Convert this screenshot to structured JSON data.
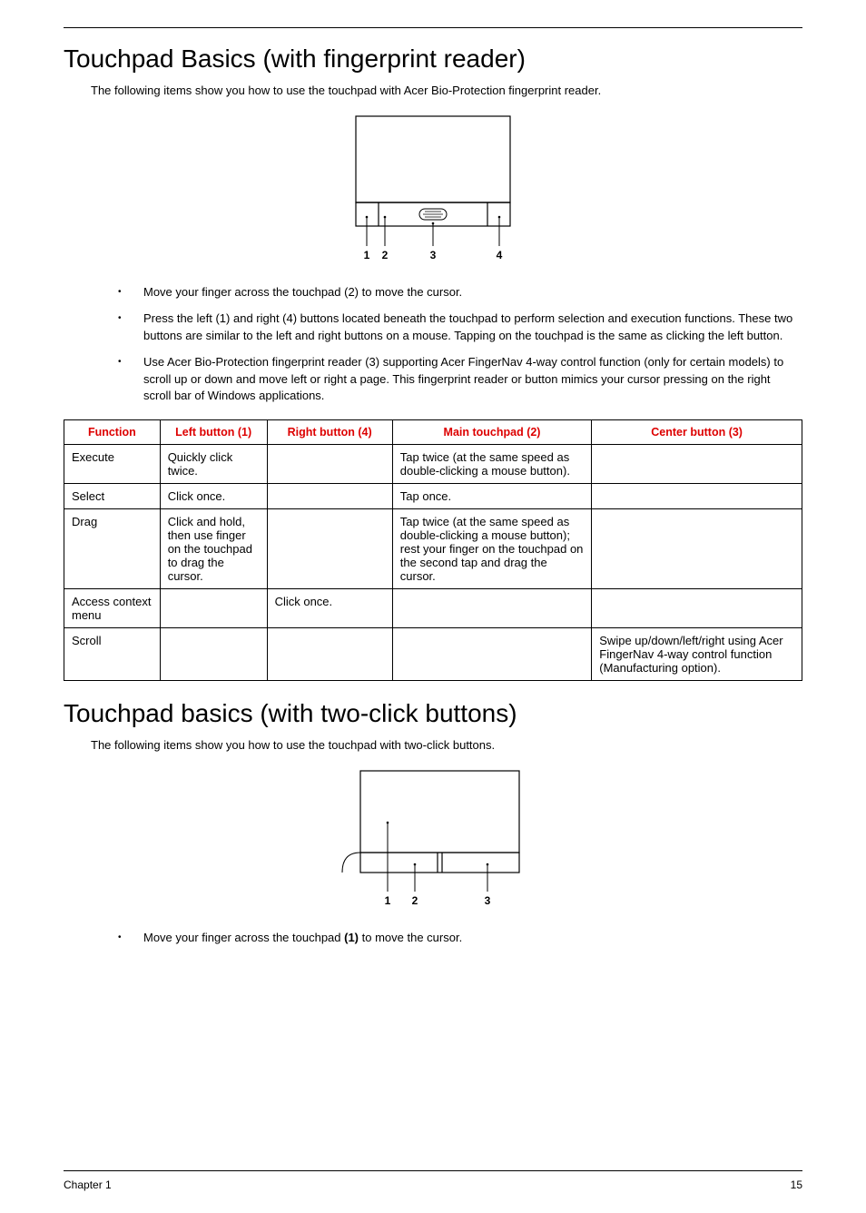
{
  "section1": {
    "heading": "Touchpad Basics (with fingerprint reader)",
    "intro": "The following items show you how to use the touchpad with Acer Bio-Protection fingerprint reader.",
    "bullets": [
      "Move your finger across the touchpad (2) to move the cursor.",
      "Press the left (1) and right (4) buttons located beneath the touchpad to perform selection and execution functions. These two buttons are similar to the left and right buttons on a mouse. Tapping on the touchpad is the same as clicking the left button.",
      "Use Acer Bio-Protection fingerprint reader (3) supporting Acer FingerNav 4-way control function (only for certain models) to scroll up or down and move left or right a page. This fingerprint reader or button mimics your cursor pressing on the right scroll bar of Windows applications."
    ],
    "diagram_labels": {
      "l1": "1",
      "l2": "2",
      "l3": "3",
      "l4": "4"
    }
  },
  "table": {
    "headers": {
      "fn": "Function",
      "left": "Left button (1)",
      "right": "Right button (4)",
      "main": "Main touchpad (2)",
      "center": "Center button (3)"
    },
    "rows": [
      {
        "fn": "Execute",
        "left": "Quickly click twice.",
        "right": "",
        "main": "Tap twice (at the same speed as double-clicking a mouse button).",
        "center": ""
      },
      {
        "fn": "Select",
        "left": "Click once.",
        "right": "",
        "main": "Tap once.",
        "center": ""
      },
      {
        "fn": "Drag",
        "left": "Click and hold, then use finger on the touchpad to drag the cursor.",
        "right": "",
        "main": "Tap twice (at the same speed as double-clicking a mouse button); rest your finger on the touchpad on the second tap and drag the cursor.",
        "center": ""
      },
      {
        "fn": "Access context menu",
        "left": "",
        "right": "Click once.",
        "main": "",
        "center": ""
      },
      {
        "fn": "Scroll",
        "left": "",
        "right": "",
        "main": "",
        "center": "Swipe up/down/left/right using Acer FingerNav 4-way control function (Manufacturing option)."
      }
    ]
  },
  "section2": {
    "heading": "Touchpad basics (with two-click buttons)",
    "intro": "The following items show you how to use the touchpad with two-click buttons.",
    "bullet_pre": "Move your finger across the touchpad ",
    "bullet_bold": "(1)",
    "bullet_post": " to move the cursor.",
    "diagram_labels": {
      "l1": "1",
      "l2": "2",
      "l3": "3"
    }
  },
  "footer": {
    "left": "Chapter 1",
    "right": "15"
  }
}
